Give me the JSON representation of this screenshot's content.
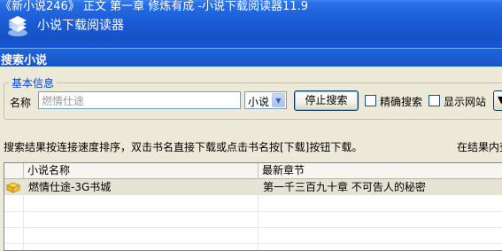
{
  "window": {
    "title": "《新小说246》 正文 第一章 修炼有成 -小说下载阅读器11.9",
    "app_name": "小说下载阅读器",
    "logo_icon": "books-logo-icon"
  },
  "dialog": {
    "title": "搜索小说"
  },
  "basic_info": {
    "legend": "基本信息",
    "name_label": "名称",
    "name_value": "燃情仕途",
    "type_selected": "小说",
    "stop_button": "停止搜索",
    "exact_search_label": "精确搜索",
    "show_site_label": "显示网站",
    "more_button": "▼"
  },
  "hints": {
    "left": "搜索结果按连接速度排序，双击书名直接下载或点击书名按[下载]按钮下载。",
    "right": "在结果内查"
  },
  "results": {
    "columns": [
      "小说名称",
      "最新章节"
    ],
    "rows": [
      {
        "name": "燃情仕途-3G书城",
        "latest_chapter": "第一千三百九十章 不可告人的秘密",
        "icon": "book-icon"
      }
    ]
  },
  "colors": {
    "titlebar": "#1b5ed8",
    "dialog_bg": "#ece9d8",
    "legend_text": "#0046d5",
    "selected_row": "#e5e3d4"
  }
}
